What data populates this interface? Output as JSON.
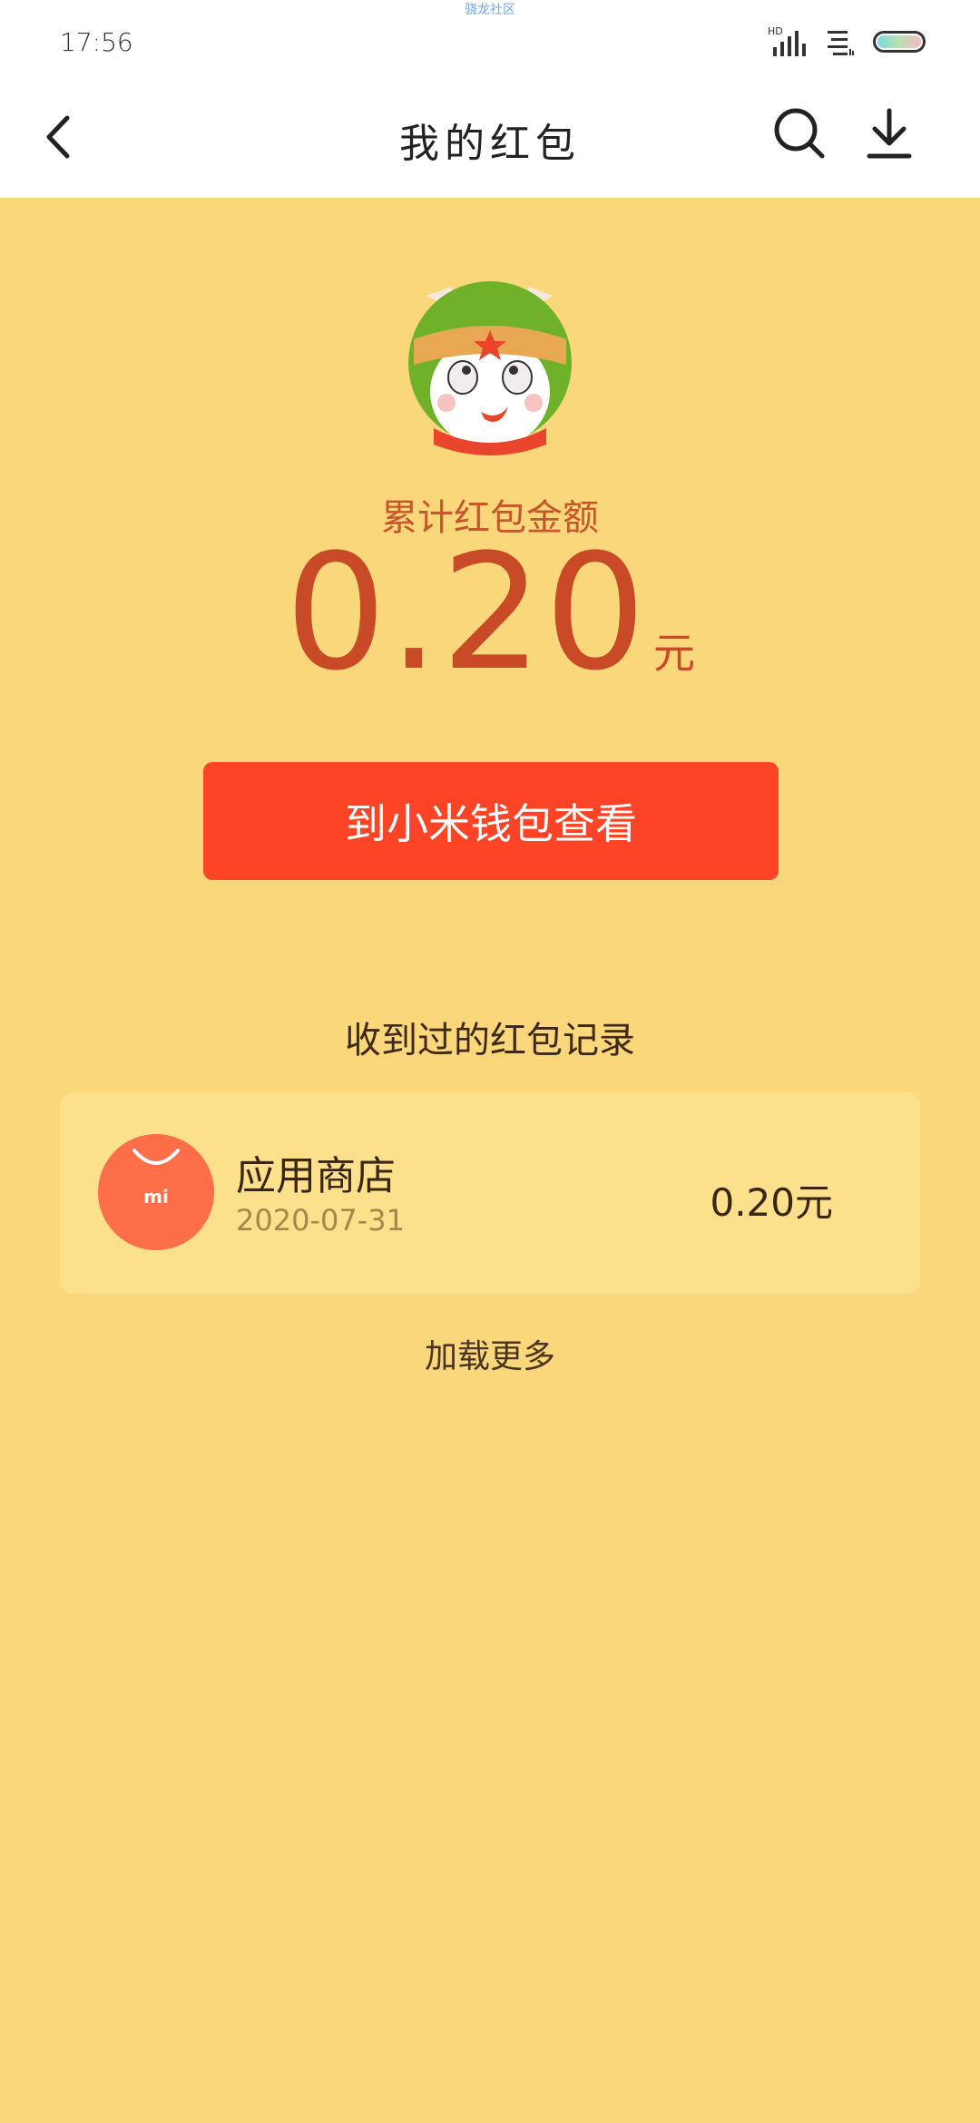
{
  "status_bar": {
    "watermark": "骁龙社区",
    "time": "17:56",
    "network_label": "HD"
  },
  "header": {
    "title": "我的红包"
  },
  "summary": {
    "label": "累计红包金额",
    "amount": "0.20",
    "unit": "元",
    "button_label": "到小米钱包查看"
  },
  "records": {
    "title": "收到过的红包记录",
    "items": [
      {
        "name": "应用商店",
        "date": "2020-07-31",
        "amount": "0.20元",
        "icon_text": "mi"
      }
    ],
    "load_more_label": "加载更多"
  },
  "colors": {
    "background": "#fad77b",
    "accent_red": "#fd4427",
    "amount_text": "#c94a27",
    "card": "#fce08c",
    "store_icon": "#fe6e48"
  }
}
